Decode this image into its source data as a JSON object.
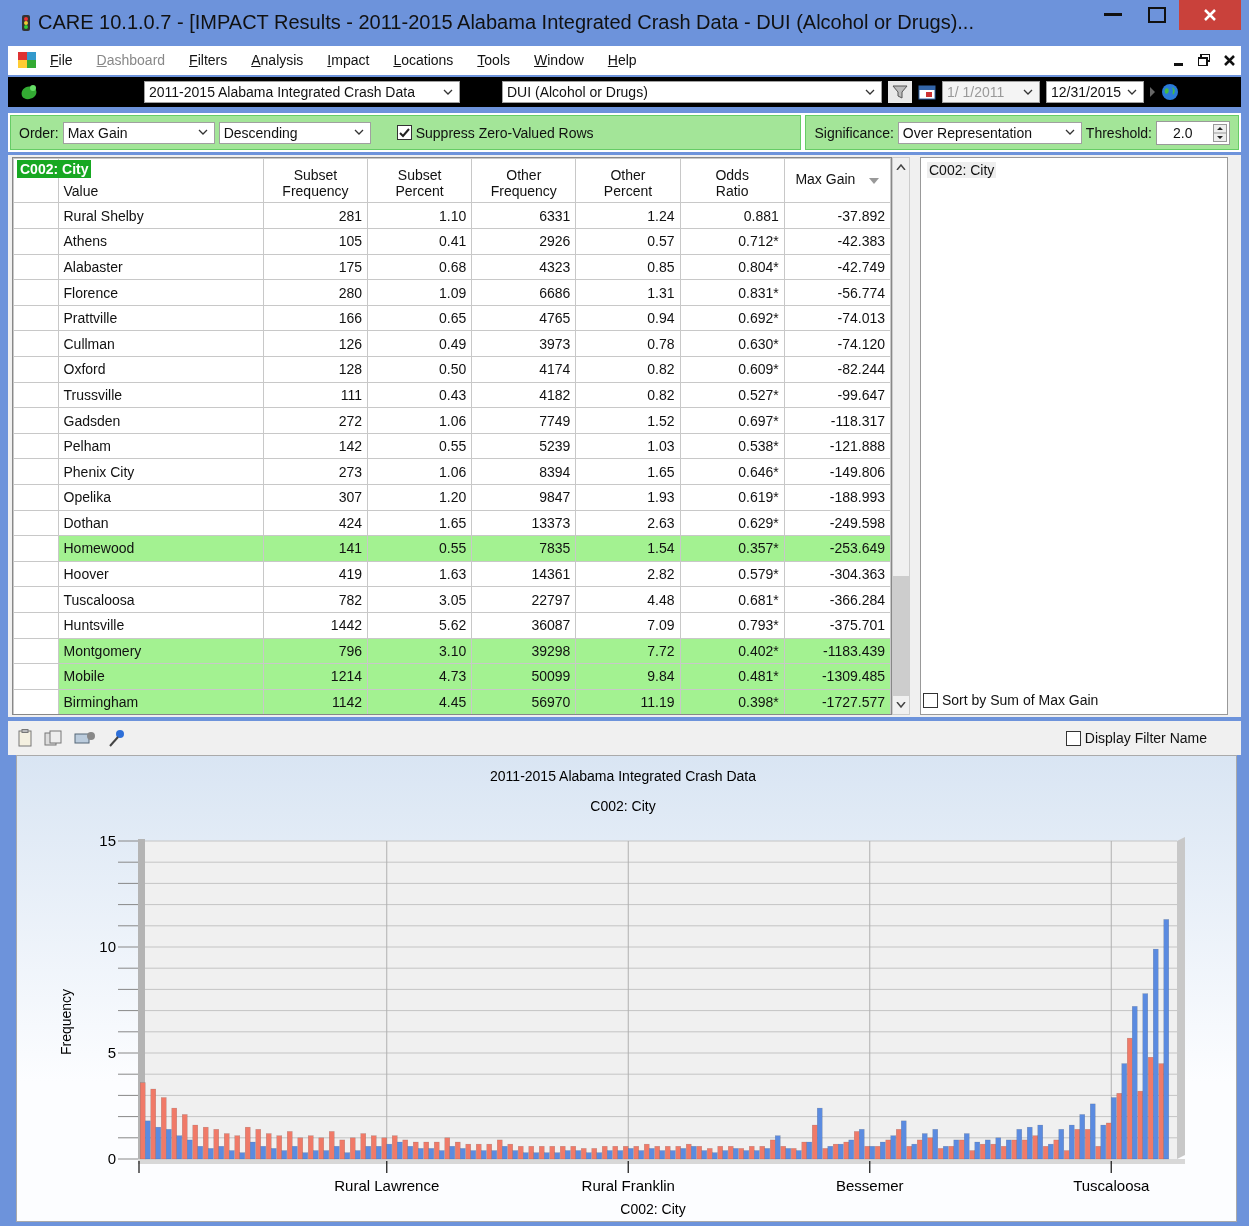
{
  "window": {
    "title": "CARE 10.1.0.7 - [IMPACT Results - 2011-2015 Alabama Integrated Crash Data - DUI (Alcohol or Drugs)..."
  },
  "menu": [
    {
      "label": "File",
      "disabled": false
    },
    {
      "label": "Dashboard",
      "disabled": true
    },
    {
      "label": "Filters",
      "disabled": false
    },
    {
      "label": "Analysis",
      "disabled": false
    },
    {
      "label": "Impact",
      "disabled": false
    },
    {
      "label": "Locations",
      "disabled": false
    },
    {
      "label": "Tools",
      "disabled": false
    },
    {
      "label": "Window",
      "disabled": false
    },
    {
      "label": "Help",
      "disabled": false
    }
  ],
  "toolbar": {
    "dataset": "2011-2015 Alabama Integrated Crash Data",
    "filter": "DUI (Alcohol or Drugs)",
    "start_date": "1/ 1/2011",
    "start_disabled": true,
    "end_date": "12/31/2015"
  },
  "options": {
    "order_label": "Order:",
    "order": "Max Gain",
    "direction": "Descending",
    "suppress_label": "Suppress Zero-Valued Rows",
    "suppress_checked": true,
    "significance_label": "Significance:",
    "significance": "Over Representation",
    "threshold_label": "Threshold:",
    "threshold": "2.0"
  },
  "table": {
    "badge": "C002: City",
    "columns": [
      {
        "label": "Value",
        "sorted": false
      },
      {
        "label": "Subset\nFrequency",
        "sorted": false
      },
      {
        "label": "Subset\nPercent",
        "sorted": false
      },
      {
        "label": "Other\nFrequency",
        "sorted": false
      },
      {
        "label": "Other\nPercent",
        "sorted": false
      },
      {
        "label": "Odds\nRatio",
        "sorted": false
      },
      {
        "label": "Max Gain",
        "sorted": true
      }
    ],
    "rows": [
      {
        "cells": [
          "Rural Shelby",
          "281",
          "1.10",
          "6331",
          "1.24",
          "0.881",
          "-37.892"
        ],
        "highlighted": false
      },
      {
        "cells": [
          "Athens",
          "105",
          "0.41",
          "2926",
          "0.57",
          "0.712*",
          "-42.383"
        ],
        "highlighted": false
      },
      {
        "cells": [
          "Alabaster",
          "175",
          "0.68",
          "4323",
          "0.85",
          "0.804*",
          "-42.749"
        ],
        "highlighted": false
      },
      {
        "cells": [
          "Florence",
          "280",
          "1.09",
          "6686",
          "1.31",
          "0.831*",
          "-56.774"
        ],
        "highlighted": false
      },
      {
        "cells": [
          "Prattville",
          "166",
          "0.65",
          "4765",
          "0.94",
          "0.692*",
          "-74.013"
        ],
        "highlighted": false
      },
      {
        "cells": [
          "Cullman",
          "126",
          "0.49",
          "3973",
          "0.78",
          "0.630*",
          "-74.120"
        ],
        "highlighted": false
      },
      {
        "cells": [
          "Oxford",
          "128",
          "0.50",
          "4174",
          "0.82",
          "0.609*",
          "-82.244"
        ],
        "highlighted": false
      },
      {
        "cells": [
          "Trussville",
          "111",
          "0.43",
          "4182",
          "0.82",
          "0.527*",
          "-99.647"
        ],
        "highlighted": false
      },
      {
        "cells": [
          "Gadsden",
          "272",
          "1.06",
          "7749",
          "1.52",
          "0.697*",
          "-118.317"
        ],
        "highlighted": false
      },
      {
        "cells": [
          "Pelham",
          "142",
          "0.55",
          "5239",
          "1.03",
          "0.538*",
          "-121.888"
        ],
        "highlighted": false
      },
      {
        "cells": [
          "Phenix City",
          "273",
          "1.06",
          "8394",
          "1.65",
          "0.646*",
          "-149.806"
        ],
        "highlighted": false
      },
      {
        "cells": [
          "Opelika",
          "307",
          "1.20",
          "9847",
          "1.93",
          "0.619*",
          "-188.993"
        ],
        "highlighted": false
      },
      {
        "cells": [
          "Dothan",
          "424",
          "1.65",
          "13373",
          "2.63",
          "0.629*",
          "-249.598"
        ],
        "highlighted": false
      },
      {
        "cells": [
          "Homewood",
          "141",
          "0.55",
          "7835",
          "1.54",
          "0.357*",
          "-253.649"
        ],
        "highlighted": true
      },
      {
        "cells": [
          "Hoover",
          "419",
          "1.63",
          "14361",
          "2.82",
          "0.579*",
          "-304.363"
        ],
        "highlighted": false
      },
      {
        "cells": [
          "Tuscaloosa",
          "782",
          "3.05",
          "22797",
          "4.48",
          "0.681*",
          "-366.284"
        ],
        "highlighted": false
      },
      {
        "cells": [
          "Huntsville",
          "1442",
          "5.62",
          "36087",
          "7.09",
          "0.793*",
          "-375.701"
        ],
        "highlighted": false
      },
      {
        "cells": [
          "Montgomery",
          "796",
          "3.10",
          "39298",
          "7.72",
          "0.402*",
          "-1183.439"
        ],
        "highlighted": true
      },
      {
        "cells": [
          "Mobile",
          "1214",
          "4.73",
          "50099",
          "9.84",
          "0.481*",
          "-1309.485"
        ],
        "highlighted": true
      },
      {
        "cells": [
          "Birmingham",
          "1142",
          "4.45",
          "56970",
          "11.19",
          "0.398*",
          "-1727.577"
        ],
        "highlighted": true
      }
    ]
  },
  "side_panel": {
    "title": "C002: City",
    "sort_label": "Sort by Sum of Max Gain",
    "sort_checked": false
  },
  "chart": {
    "display_filter_label": "Display Filter Name",
    "display_filter_checked": false,
    "subtitle": "C002: City",
    "chart_data": {
      "type": "bar",
      "title": "2011-2015 Alabama Integrated Crash Data",
      "xlabel": "C002: City",
      "ylabel": "Frequency",
      "ylim": [
        0,
        15
      ],
      "grid": true,
      "yticks": [
        0,
        5,
        10,
        15
      ],
      "categories": [
        null,
        null,
        null,
        null,
        null,
        null,
        null,
        null,
        null,
        null,
        null,
        null,
        null,
        null,
        null,
        null,
        null,
        null,
        null,
        null,
        null,
        null,
        null,
        "Rural Lawrence",
        null,
        null,
        null,
        null,
        null,
        null,
        null,
        null,
        null,
        null,
        null,
        null,
        null,
        null,
        null,
        null,
        null,
        null,
        null,
        null,
        null,
        null,
        "Rural Franklin",
        null,
        null,
        null,
        null,
        null,
        null,
        null,
        null,
        null,
        null,
        null,
        null,
        null,
        null,
        null,
        null,
        null,
        null,
        null,
        null,
        null,
        null,
        "Bessemer",
        null,
        null,
        null,
        null,
        null,
        null,
        null,
        null,
        null,
        null,
        null,
        null,
        null,
        null,
        null,
        null,
        null,
        null,
        null,
        null,
        null,
        null,
        "Tuscaloosa",
        null,
        null,
        null,
        null,
        null
      ],
      "series": [
        {
          "color": "#f07a68",
          "values": [
            3.6,
            3.3,
            2.9,
            2.4,
            2.1,
            1.6,
            1.5,
            1.4,
            1.2,
            1.1,
            1.5,
            1.4,
            1.2,
            1.1,
            1.3,
            1.0,
            1.1,
            1.0,
            1.3,
            0.9,
            1.0,
            1.2,
            1.1,
            1.0,
            1.1,
            0.9,
            0.8,
            0.8,
            0.8,
            1.0,
            0.8,
            0.7,
            0.7,
            0.7,
            0.9,
            0.7,
            0.6,
            0.6,
            0.6,
            0.6,
            0.6,
            0.6,
            0.5,
            0.5,
            0.6,
            0.6,
            0.6,
            0.6,
            0.7,
            0.6,
            0.6,
            0.6,
            0.7,
            0.6,
            0.5,
            0.6,
            0.6,
            0.5,
            0.6,
            0.6,
            0.9,
            0.6,
            0.5,
            0.8,
            1.6,
            0.5,
            0.7,
            0.8,
            1.3,
            0.6,
            0.6,
            0.9,
            1.4,
            0.6,
            0.9,
            1.0,
            0.5,
            0.6,
            0.9,
            0.4,
            0.7,
            0.7,
            0.6,
            0.9,
            0.9,
            1.1,
            0.6,
            0.9,
            0.4,
            1.4,
            1.4,
            0.6,
            1.7,
            3.1,
            5.7,
            3.2,
            4.8,
            4.5
          ]
        },
        {
          "color": "#5b8be0",
          "values": [
            1.8,
            1.5,
            1.4,
            1.1,
            0.9,
            0.6,
            0.5,
            0.6,
            0.4,
            0.3,
            0.8,
            0.6,
            0.5,
            0.4,
            0.6,
            0.3,
            0.4,
            0.4,
            0.6,
            0.3,
            0.4,
            0.6,
            0.6,
            0.7,
            0.8,
            0.6,
            0.5,
            0.5,
            0.4,
            0.6,
            0.5,
            0.4,
            0.4,
            0.4,
            0.6,
            0.4,
            0.3,
            0.3,
            0.3,
            0.3,
            0.4,
            0.4,
            0.3,
            0.3,
            0.4,
            0.4,
            0.5,
            0.4,
            0.5,
            0.4,
            0.4,
            0.5,
            0.6,
            0.4,
            0.3,
            0.4,
            0.5,
            0.4,
            0.4,
            0.5,
            1.1,
            0.5,
            0.4,
            0.8,
            2.4,
            0.6,
            0.7,
            0.9,
            1.4,
            0.6,
            0.8,
            1.1,
            1.8,
            0.7,
            1.2,
            1.4,
            0.6,
            0.9,
            1.2,
            0.8,
            0.9,
            1.0,
            0.9,
            1.4,
            1.5,
            1.6,
            0.7,
            1.4,
            1.6,
            2.1,
            2.6,
            1.6,
            2.9,
            4.5,
            7.2,
            7.8,
            9.9,
            11.3
          ]
        }
      ]
    }
  }
}
